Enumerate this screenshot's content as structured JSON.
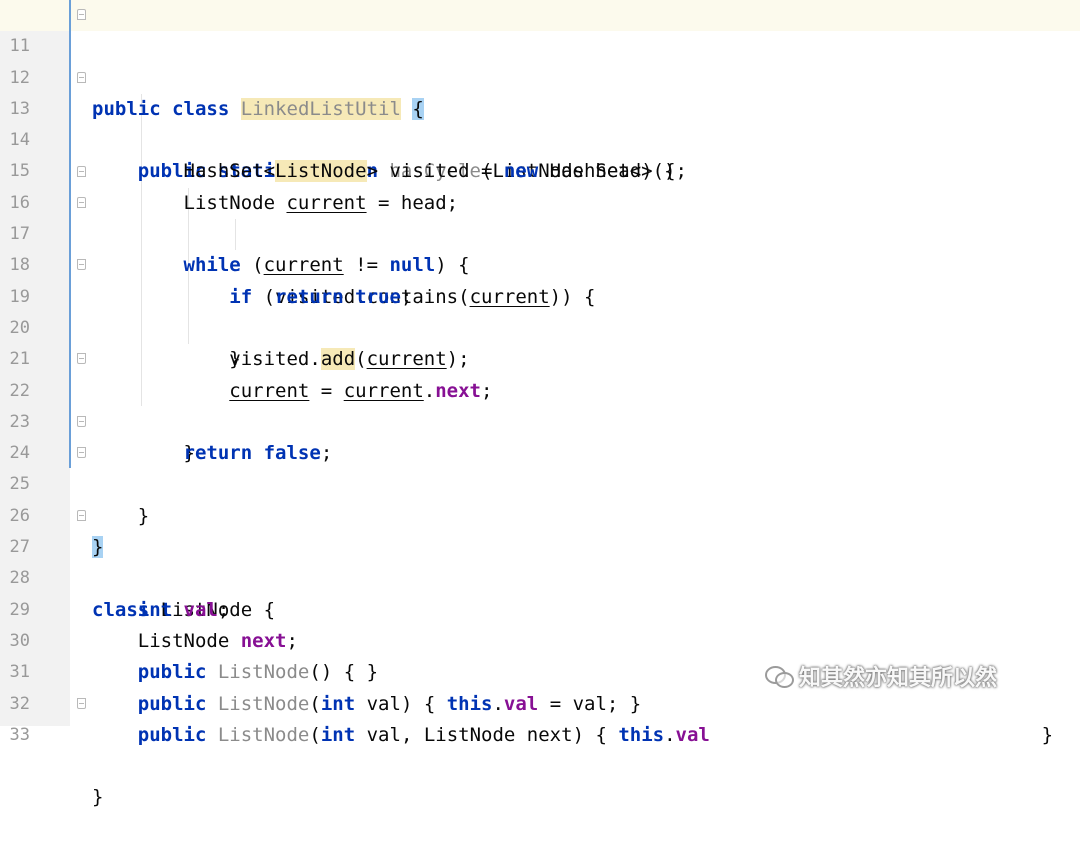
{
  "editor": {
    "language": "Java",
    "current_line": 11,
    "lines": [
      {
        "n": "11"
      },
      {
        "n": "12"
      },
      {
        "n": "13"
      },
      {
        "n": "14"
      },
      {
        "n": "15"
      },
      {
        "n": "16"
      },
      {
        "n": "17"
      },
      {
        "n": "18"
      },
      {
        "n": "19"
      },
      {
        "n": "20"
      },
      {
        "n": "21"
      },
      {
        "n": "22"
      },
      {
        "n": "23"
      },
      {
        "n": "24"
      },
      {
        "n": "25"
      },
      {
        "n": "26"
      },
      {
        "n": "27"
      },
      {
        "n": "28"
      },
      {
        "n": "29"
      },
      {
        "n": "30"
      },
      {
        "n": "31"
      },
      {
        "n": "32"
      },
      {
        "n": "33"
      }
    ],
    "tokens": {
      "public": "public",
      "class": "class",
      "static": "static",
      "boolean": "boolean",
      "new": "new",
      "while": "while",
      "null": "null",
      "if": "if",
      "return": "return",
      "true": "true",
      "false": "false",
      "int": "int",
      "this": "this",
      "LinkedListUtil": "LinkedListUtil",
      "hasCycle": "hasCycle",
      "ListNode": "ListNode",
      "HashSet": "HashSet",
      "visited": "visited",
      "current": "current",
      "head": "head",
      "contains": "contains",
      "add": "add",
      "next": "next",
      "val": "val"
    }
  },
  "watermark": {
    "text": "知其然亦知其所以然",
    "icon": "wechat-icon"
  }
}
